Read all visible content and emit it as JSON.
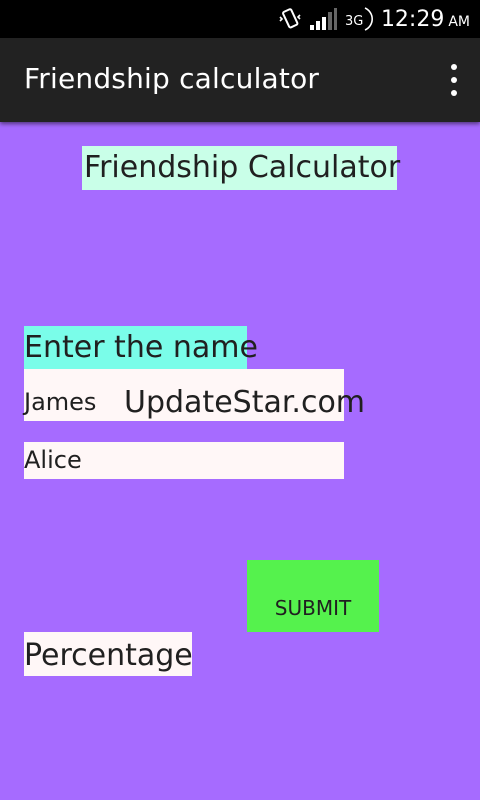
{
  "status_bar": {
    "network_type": "3G",
    "time": "12:29",
    "ampm": "AM",
    "icons": [
      "vibrate-icon",
      "signal-icon",
      "network-3g-icon"
    ]
  },
  "app_bar": {
    "title": "Friendship calculator",
    "menu_icon": "overflow-menu-icon"
  },
  "main": {
    "heading": "Friendship Calculator",
    "enter_label": "Enter the name",
    "name1_value": "James",
    "name2_value": "Alice",
    "watermark": "UpdateStar.com",
    "submit_label": "SUBMIT",
    "percentage_label": "Percentage"
  },
  "colors": {
    "background": "#a66bff",
    "heading_bg": "#c9ffe8",
    "label_bg": "#7afde9",
    "field_bg": "#fff7f7",
    "button_bg": "#55f24d",
    "action_bar": "#222222"
  }
}
